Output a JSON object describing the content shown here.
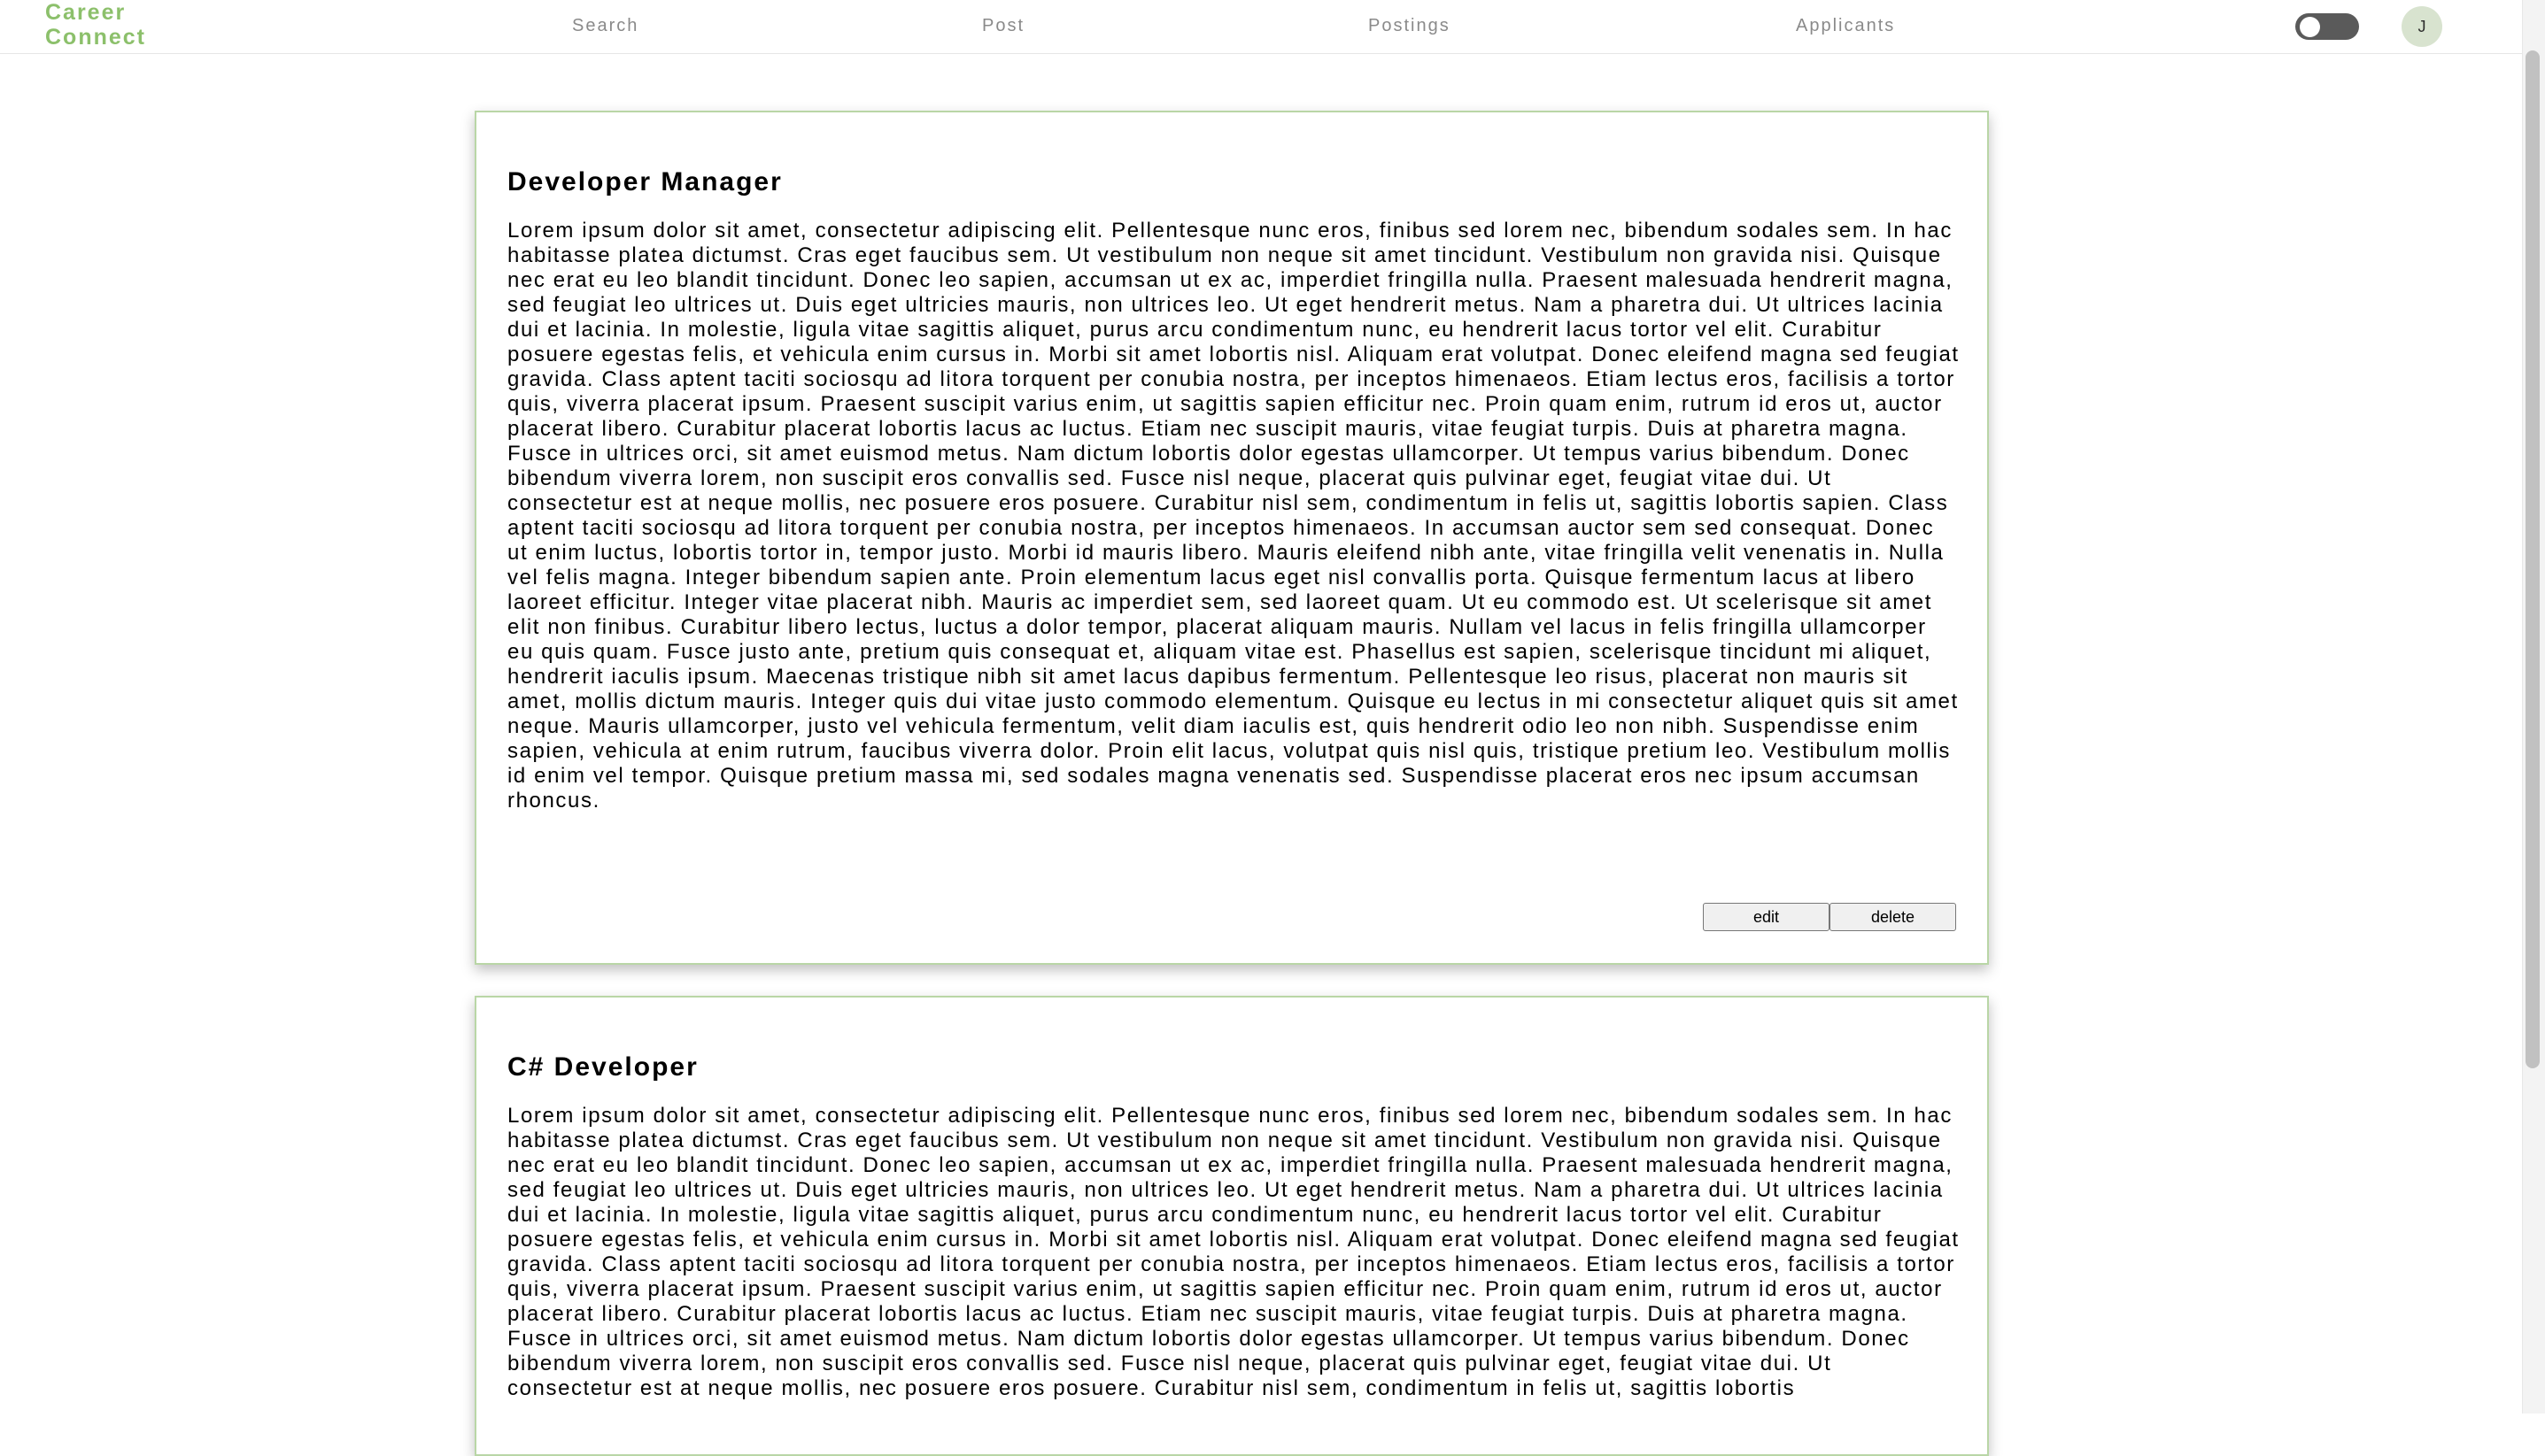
{
  "header": {
    "logo_line1": "Career",
    "logo_line2": "Connect",
    "nav": {
      "search": "Search",
      "post": "Post",
      "postings": "Postings",
      "applicants": "Applicants"
    },
    "theme_toggle": {
      "state": "off"
    },
    "avatar_initial": "J"
  },
  "postings": [
    {
      "title": "Developer Manager",
      "description": "Lorem ipsum dolor sit amet, consectetur adipiscing elit. Pellentesque nunc eros, finibus sed lorem nec, bibendum sodales sem. In hac habitasse platea dictumst. Cras eget faucibus sem. Ut vestibulum non neque sit amet tincidunt. Vestibulum non gravida nisi. Quisque nec erat eu leo blandit tincidunt. Donec leo sapien, accumsan ut ex ac, imperdiet fringilla nulla. Praesent malesuada hendrerit magna, sed feugiat leo ultrices ut. Duis eget ultricies mauris, non ultrices leo. Ut eget hendrerit metus. Nam a pharetra dui. Ut ultrices lacinia dui et lacinia. In molestie, ligula vitae sagittis aliquet, purus arcu condimentum nunc, eu hendrerit lacus tortor vel elit. Curabitur posuere egestas felis, et vehicula enim cursus in. Morbi sit amet lobortis nisl. Aliquam erat volutpat. Donec eleifend magna sed feugiat gravida. Class aptent taciti sociosqu ad litora torquent per conubia nostra, per inceptos himenaeos. Etiam lectus eros, facilisis a tortor quis, viverra placerat ipsum. Praesent suscipit varius enim, ut sagittis sapien efficitur nec. Proin quam enim, rutrum id eros ut, auctor placerat libero. Curabitur placerat lobortis lacus ac luctus. Etiam nec suscipit mauris, vitae feugiat turpis. Duis at pharetra magna. Fusce in ultrices orci, sit amet euismod metus. Nam dictum lobortis dolor egestas ullamcorper. Ut tempus varius bibendum. Donec bibendum viverra lorem, non suscipit eros convallis sed. Fusce nisl neque, placerat quis pulvinar eget, feugiat vitae dui. Ut consectetur est at neque mollis, nec posuere eros posuere. Curabitur nisl sem, condimentum in felis ut, sagittis lobortis sapien. Class aptent taciti sociosqu ad litora torquent per conubia nostra, per inceptos himenaeos. In accumsan auctor sem sed consequat. Donec ut enim luctus, lobortis tortor in, tempor justo. Morbi id mauris libero. Mauris eleifend nibh ante, vitae fringilla velit venenatis in. Nulla vel felis magna. Integer bibendum sapien ante. Proin elementum lacus eget nisl convallis porta. Quisque fermentum lacus at libero laoreet efficitur. Integer vitae placerat nibh. Mauris ac imperdiet sem, sed laoreet quam. Ut eu commodo est. Ut scelerisque sit amet elit non finibus. Curabitur libero lectus, luctus a dolor tempor, placerat aliquam mauris. Nullam vel lacus in felis fringilla ullamcorper eu quis quam. Fusce justo ante, pretium quis consequat et, aliquam vitae est. Phasellus est sapien, scelerisque tincidunt mi aliquet, hendrerit iaculis ipsum. Maecenas tristique nibh sit amet lacus dapibus fermentum. Pellentesque leo risus, placerat non mauris sit amet, mollis dictum mauris. Integer quis dui vitae justo commodo elementum. Quisque eu lectus in mi consectetur aliquet quis sit amet neque. Mauris ullamcorper, justo vel vehicula fermentum, velit diam iaculis est, quis hendrerit odio leo non nibh. Suspendisse enim sapien, vehicula at enim rutrum, faucibus viverra dolor. Proin elit lacus, volutpat quis nisl quis, tristique pretium leo. Vestibulum mollis id enim vel tempor. Quisque pretium massa mi, sed sodales magna venenatis sed. Suspendisse placerat eros nec ipsum accumsan rhoncus.",
      "edit_label": "edit",
      "delete_label": "delete"
    },
    {
      "title": "C# Developer",
      "description": "Lorem ipsum dolor sit amet, consectetur adipiscing elit. Pellentesque nunc eros, finibus sed lorem nec, bibendum sodales sem. In hac habitasse platea dictumst. Cras eget faucibus sem. Ut vestibulum non neque sit amet tincidunt. Vestibulum non gravida nisi. Quisque nec erat eu leo blandit tincidunt. Donec leo sapien, accumsan ut ex ac, imperdiet fringilla nulla. Praesent malesuada hendrerit magna, sed feugiat leo ultrices ut. Duis eget ultricies mauris, non ultrices leo. Ut eget hendrerit metus. Nam a pharetra dui. Ut ultrices lacinia dui et lacinia. In molestie, ligula vitae sagittis aliquet, purus arcu condimentum nunc, eu hendrerit lacus tortor vel elit. Curabitur posuere egestas felis, et vehicula enim cursus in. Morbi sit amet lobortis nisl. Aliquam erat volutpat. Donec eleifend magna sed feugiat gravida. Class aptent taciti sociosqu ad litora torquent per conubia nostra, per inceptos himenaeos. Etiam lectus eros, facilisis a tortor quis, viverra placerat ipsum. Praesent suscipit varius enim, ut sagittis sapien efficitur nec. Proin quam enim, rutrum id eros ut, auctor placerat libero. Curabitur placerat lobortis lacus ac luctus. Etiam nec suscipit mauris, vitae feugiat turpis. Duis at pharetra magna. Fusce in ultrices orci, sit amet euismod metus. Nam dictum lobortis dolor egestas ullamcorper. Ut tempus varius bibendum. Donec bibendum viverra lorem, non suscipit eros convallis sed. Fusce nisl neque, placerat quis pulvinar eget, feugiat vitae dui. Ut consectetur est at neque mollis, nec posuere eros posuere. Curabitur nisl sem, condimentum in felis ut, sagittis lobortis"
    }
  ],
  "colors": {
    "brand": "#8cc06b",
    "card_border": "#b9d6a6",
    "nav_text": "#8a8a8a",
    "toggle_track": "#5a5a5a",
    "avatar_bg": "#d8e3cf"
  }
}
